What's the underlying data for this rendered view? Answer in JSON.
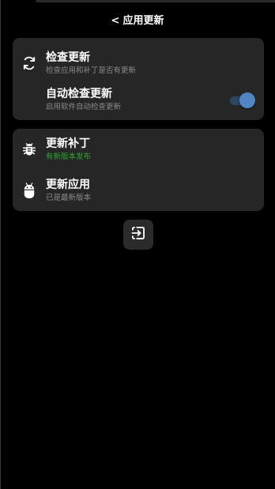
{
  "header": {
    "back_glyph": "<",
    "title": "应用更新"
  },
  "settings_card": {
    "check_update": {
      "icon": "refresh-icon",
      "title": "检查更新",
      "subtitle": "检查应用和补丁是否有更新"
    },
    "auto_check": {
      "title": "自动检查更新",
      "subtitle": "启用软件自动检查更新",
      "enabled": true
    }
  },
  "update_card": {
    "patch": {
      "icon": "bug-icon",
      "title": "更新补丁",
      "subtitle": "有新版本发布"
    },
    "app": {
      "icon": "android-icon",
      "title": "更新应用",
      "subtitle": "已是最新版本"
    }
  },
  "exit_button": {
    "icon": "exit-icon"
  },
  "colors": {
    "background": "#000000",
    "card": "#262626",
    "accent_blue": "#4f86c2",
    "status_green": "#2fa52f",
    "subtitle_gray": "#8a8a8a"
  }
}
